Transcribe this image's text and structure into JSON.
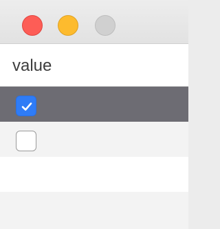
{
  "window": {
    "traffic_lights": {
      "close_color": "#fd5d56",
      "minimize_color": "#fdbb2e",
      "zoom_color": "#d0d0d0"
    }
  },
  "table": {
    "column_header": "value",
    "rows": [
      {
        "checked": true,
        "selected": true
      },
      {
        "checked": false,
        "selected": false
      }
    ]
  },
  "colors": {
    "selected_row": "#6d6c73",
    "checkbox_accent": "#2f7cf6"
  }
}
